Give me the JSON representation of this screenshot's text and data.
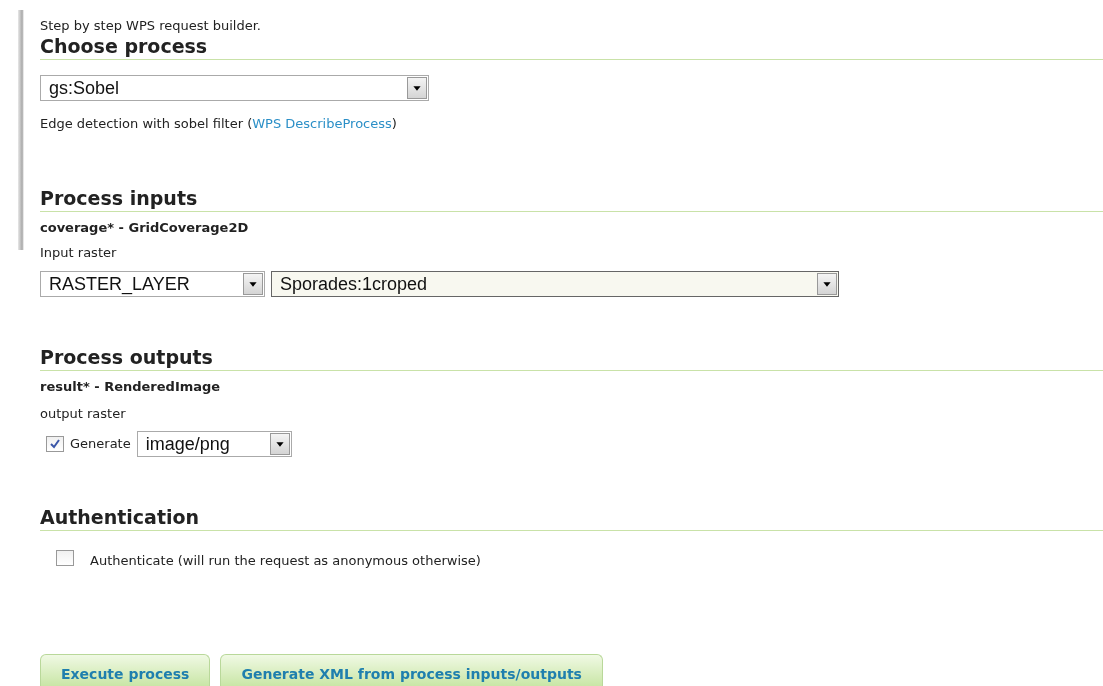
{
  "intro": "Step by step WPS request builder.",
  "choose_process": {
    "heading": "Choose process",
    "process": "gs:Sobel",
    "description_before": "Edge detection with sobel filter (",
    "link": "WPS DescribeProcess",
    "description_after": ")"
  },
  "process_inputs": {
    "heading": "Process inputs",
    "inputs": [
      {
        "name": "coverage* - GridCoverage2D",
        "description": "Input raster",
        "type": "RASTER_LAYER",
        "value": "Sporades:1croped"
      }
    ]
  },
  "process_outputs": {
    "heading": "Process outputs",
    "outputs": [
      {
        "name": "result* - RenderedImage",
        "description": "output raster",
        "checked": true,
        "generate_label": "Generate",
        "format": "image/png"
      }
    ]
  },
  "authentication": {
    "heading": "Authentication",
    "checked": false,
    "label": "Authenticate (will run the request as anonymous otherwise)"
  },
  "buttons": [
    "Execute process",
    "Generate XML from process inputs/outputs"
  ]
}
